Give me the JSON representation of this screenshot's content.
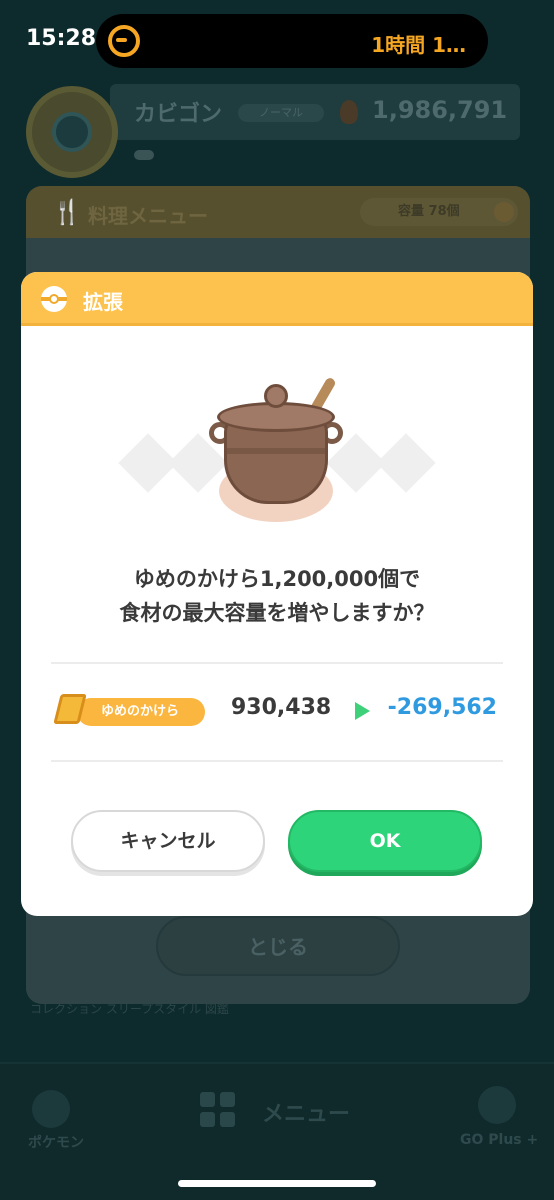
{
  "status_bar": {
    "time": "15:28",
    "activity_text": "1時間 1…",
    "activity_icon": "timer-icon"
  },
  "background_app": {
    "pokemon_name": "カビゴン",
    "rank_text": "ノーマル",
    "energy": "1,986,791",
    "panel_title": "料理メニュー",
    "capacity_label": "容量 78個",
    "close_label": "とじる",
    "caption": "コレクション スリープスタイル 図鑑",
    "nav": {
      "left": "ポケモン",
      "center": "メニュー",
      "right": "GO Plus +"
    }
  },
  "dialog": {
    "title": "拡張",
    "question_line1": "ゆめのかけら1,200,000個で",
    "question_line2": "食材の最大容量を増やしますか？",
    "currency_label": "ゆめのかけら",
    "current_amount": "930,438",
    "resulting_amount": "-269,562",
    "cancel_label": "キャンセル",
    "ok_label": "OK"
  },
  "colors": {
    "header_yellow": "#fdc24d",
    "ok_green": "#2ed47a",
    "delta_blue": "#2f9ae0",
    "timer_orange": "#f5a623"
  }
}
